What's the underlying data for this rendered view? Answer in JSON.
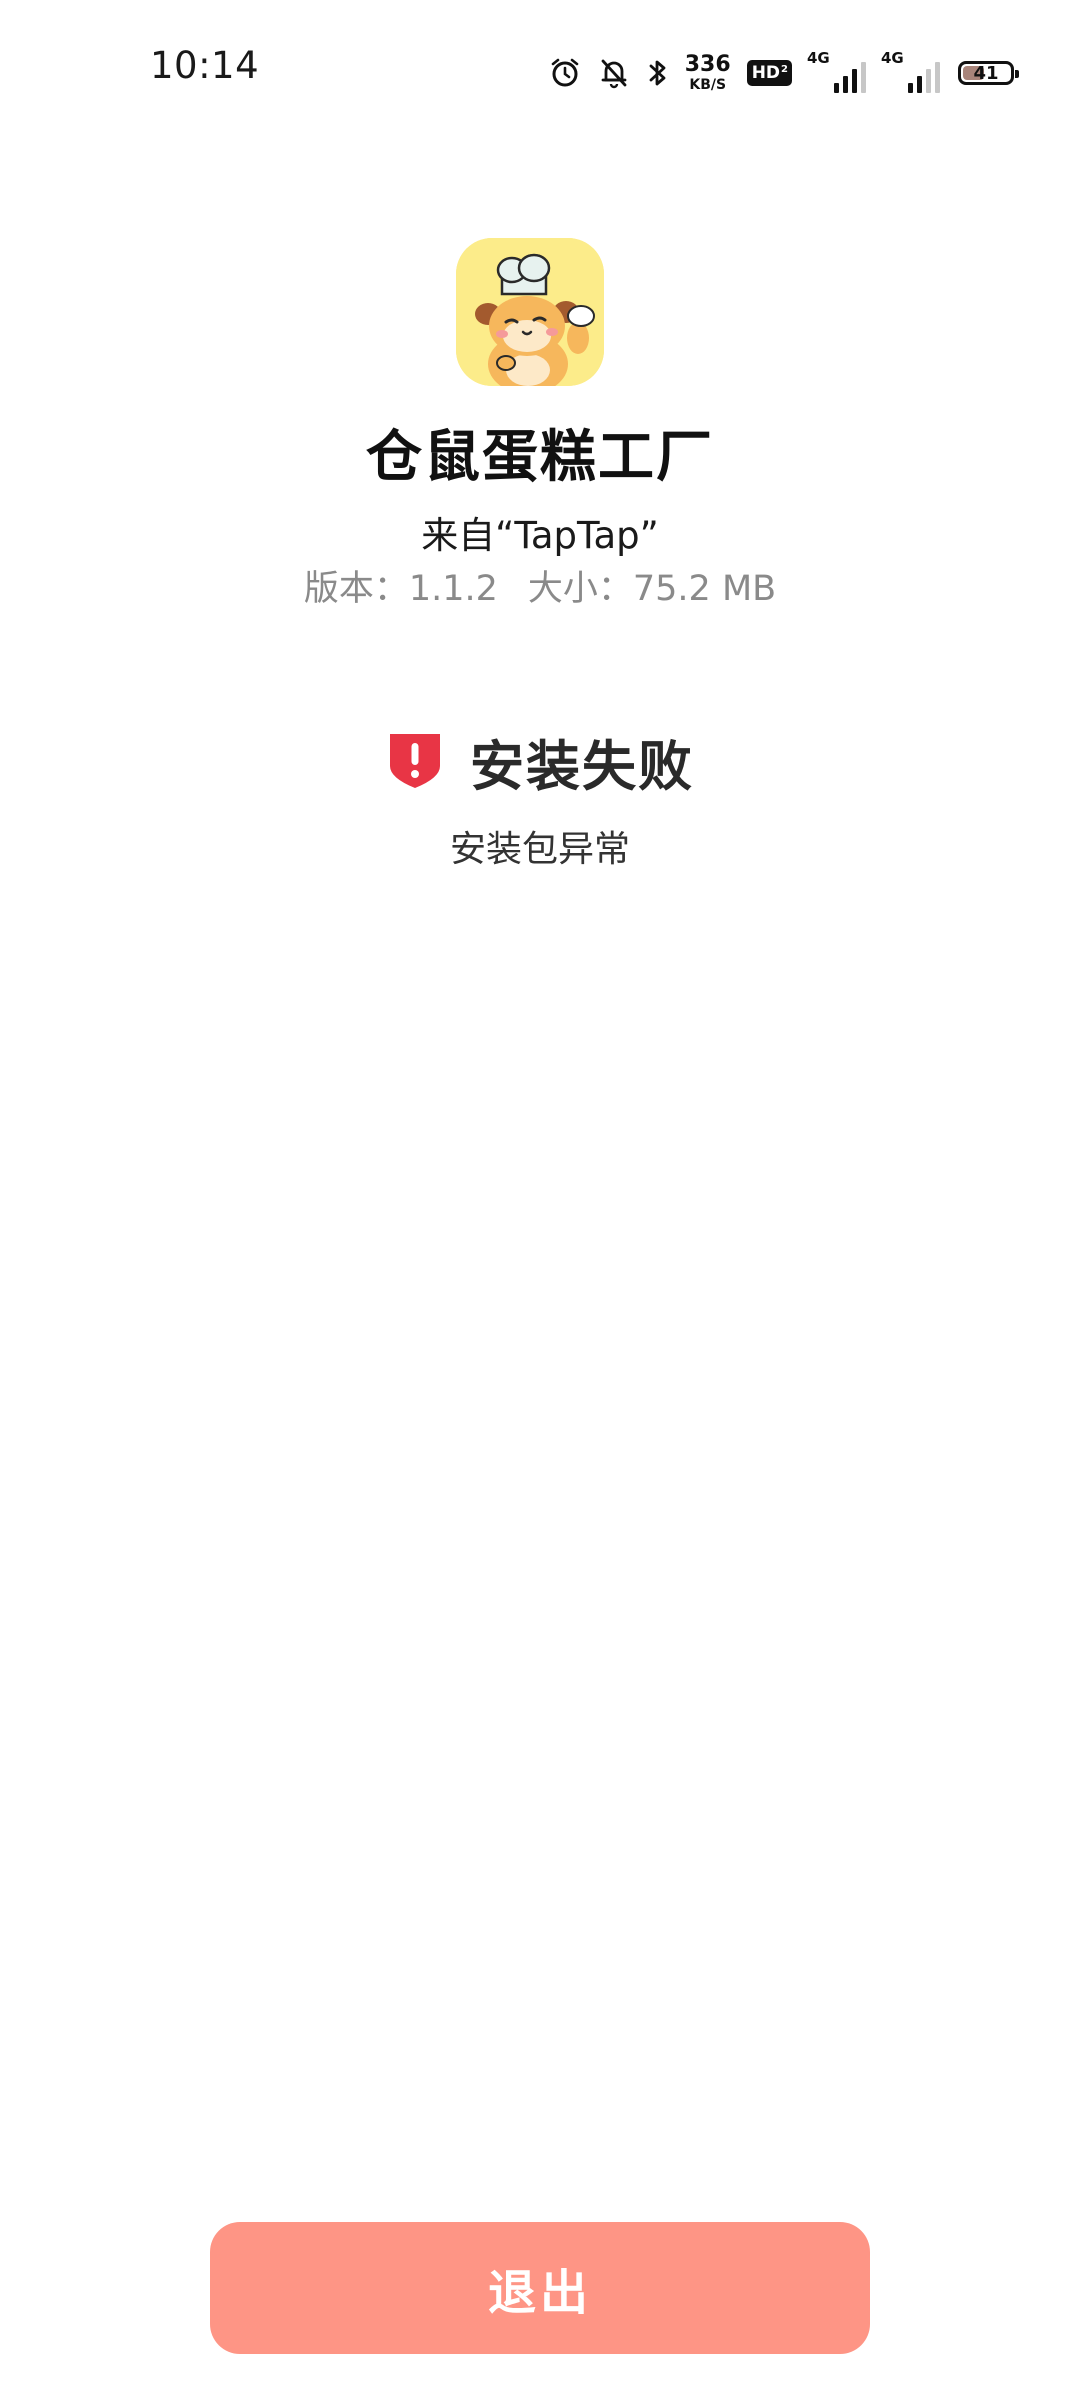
{
  "status_bar": {
    "time": "10:14",
    "net_speed_value": "336",
    "net_speed_unit": "KB/S",
    "hd_label": "HD",
    "hd_sub": "2",
    "sim1_type": "4G",
    "sim2_type": "4G",
    "battery_level": "41",
    "icons": [
      "alarm-icon",
      "mute-bell-icon",
      "bluetooth-icon"
    ]
  },
  "app": {
    "name": "仓鼠蛋糕工厂",
    "source": "来自“TapTap”",
    "version_text": "版本：1.1.2",
    "size_text": "大小：75.2 MB",
    "icon": "hamster-chef-app-icon"
  },
  "result": {
    "title": "安装失败",
    "description": "安装包异常",
    "icon": "shield-alert-icon",
    "icon_color": "#e83545"
  },
  "footer": {
    "exit_label": "退出",
    "exit_color": "#fe9585"
  }
}
